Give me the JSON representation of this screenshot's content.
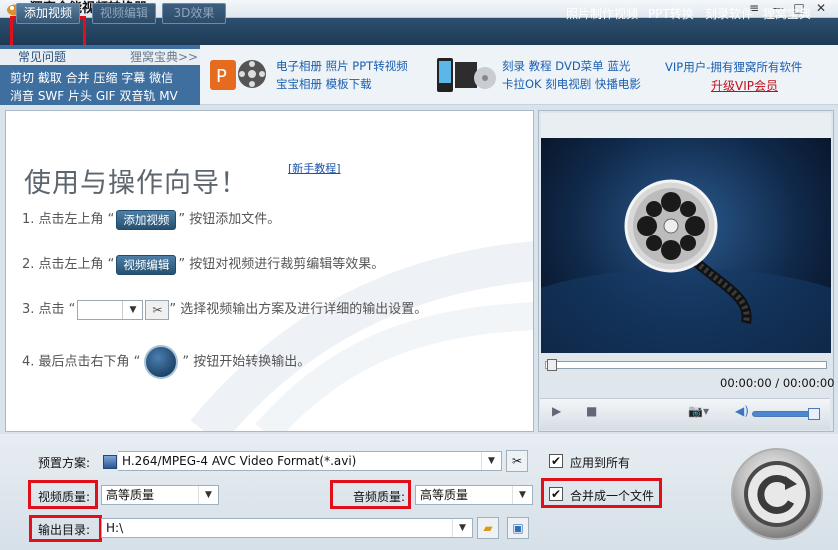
{
  "window": {
    "title": "狸窝全能视频转换器",
    "minimize": "—",
    "maximize": "□",
    "close": "✕",
    "menu": "≡"
  },
  "toolbar": {
    "add_video": "添加视频",
    "edit_video": "视频编辑",
    "effect_3d": "3D效果",
    "links": [
      "照片制作视频",
      "PPT转换",
      "刻录软件",
      "狸窝宝典"
    ]
  },
  "faq": {
    "title": "常见问题",
    "baodian": "狸窝宝典>>",
    "row1": "剪切 截取 合并 压缩 字幕 微信",
    "row2": "消音 SWF 片头 GIF 双音轨 MV"
  },
  "promo1": {
    "line1": "电子相册 照片 PPT转视频",
    "line2": "宝宝相册 模板下载"
  },
  "promo2": {
    "line1": "刻录 教程 DVD菜单 蓝光",
    "line2": "卡拉OK 刻电视剧 快播电影"
  },
  "vip": {
    "line1": "VIP用户-拥有狸窝所有软件",
    "line2": "升级VIP会员"
  },
  "guide": {
    "title": "使用与操作向导！",
    "tutorial": "[新手教程]",
    "step1_pre": "1. 点击左上角 “",
    "step1_chip": "添加视频",
    "step1_post": "” 按钮添加文件。",
    "step2_pre": "2. 点击左上角 “",
    "step2_chip": "视频编辑",
    "step2_post": "” 按钮对视频进行裁剪编辑等效果。",
    "step3_pre": "3. 点击 “",
    "step3_post": "” 选择视频输出方案及进行详细的输出设置。",
    "step4_pre": "4. 最后点击右下角 “",
    "step4_post": "” 按钮开始转换输出。"
  },
  "player": {
    "time": "00:00:00 / 00:00:00",
    "progress": 0,
    "volume": 0.85
  },
  "settings": {
    "preset_label": "预置方案:",
    "preset_value": "H.264/MPEG-4 AVC Video Format(*.avi)",
    "video_quality_label": "视频质量:",
    "video_quality_value": "高等质量",
    "audio_quality_label": "音频质量:",
    "audio_quality_value": "高等质量",
    "output_label": "输出目录:",
    "output_value": "H:\\",
    "apply_all": "应用到所有",
    "merge": "合并成一个文件"
  },
  "colors": {
    "highlight": "#e0101a",
    "toolbar": "#1d3a55",
    "link": "#1a5eb0"
  }
}
